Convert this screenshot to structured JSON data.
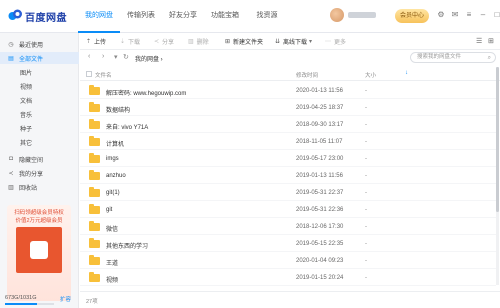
{
  "app": {
    "title": "百度网盘"
  },
  "nav": [
    {
      "label": "我的网盘",
      "active": true
    },
    {
      "label": "传输列表",
      "active": false
    },
    {
      "label": "好友分享",
      "active": false
    },
    {
      "label": "功能宝箱",
      "active": false
    },
    {
      "label": "找资源",
      "active": false
    }
  ],
  "header": {
    "member_label": "会员中心"
  },
  "sidebar": {
    "items": [
      {
        "icon": "clock-icon",
        "glyph": "◷",
        "label": "最近使用",
        "active": false,
        "sub": false
      },
      {
        "icon": "files-icon",
        "glyph": "▤",
        "label": "全部文件",
        "active": true,
        "sub": false
      },
      {
        "icon": "",
        "glyph": "",
        "label": "图片",
        "active": false,
        "sub": true
      },
      {
        "icon": "",
        "glyph": "",
        "label": "视频",
        "active": false,
        "sub": true
      },
      {
        "icon": "",
        "glyph": "",
        "label": "文档",
        "active": false,
        "sub": true
      },
      {
        "icon": "",
        "glyph": "",
        "label": "音乐",
        "active": false,
        "sub": true
      },
      {
        "icon": "",
        "glyph": "",
        "label": "种子",
        "active": false,
        "sub": true
      },
      {
        "icon": "",
        "glyph": "",
        "label": "其它",
        "active": false,
        "sub": true
      },
      {
        "icon": "lock-icon",
        "glyph": "◘",
        "label": "隐藏空间",
        "active": false,
        "sub": false
      },
      {
        "icon": "share-icon",
        "glyph": "≺",
        "label": "我的分享",
        "active": false,
        "sub": false
      },
      {
        "icon": "trash-icon",
        "glyph": "▥",
        "label": "回收站",
        "active": false,
        "sub": false
      }
    ],
    "promo": {
      "line1": "扫码领超级会员特权",
      "line2": "价值2万元超级会员"
    },
    "storage": {
      "text": "673G/1031G",
      "expand_label": "扩容",
      "used_fraction": 0.653
    }
  },
  "toolbar": {
    "upload": "上传",
    "download": "下载",
    "share": "分享",
    "delete": "删除",
    "new_folder": "新建文件夹",
    "offline_download": "离线下载",
    "more": "更多"
  },
  "path": {
    "crumb": "我的网盘 ›",
    "search_placeholder": "搜索我的网盘文件"
  },
  "table": {
    "headers": {
      "name": "文件名",
      "date": "修改时间",
      "size": "大小"
    },
    "rows": [
      {
        "name": "解压密码: www.hegouwip.com",
        "date": "2020-01-13 11:56",
        "size": "-"
      },
      {
        "name": "数据结构",
        "date": "2019-04-25 18:37",
        "size": "-"
      },
      {
        "name": "来自: vivo Y71A",
        "date": "2018-09-30 13:17",
        "size": "-"
      },
      {
        "name": "计算机",
        "date": "2018-11-05 11:07",
        "size": "-"
      },
      {
        "name": "imgs",
        "date": "2019-05-17 23:00",
        "size": "-"
      },
      {
        "name": "anzhuo",
        "date": "2019-01-13 11:56",
        "size": "-"
      },
      {
        "name": "git(1)",
        "date": "2019-05-31 22:37",
        "size": "-"
      },
      {
        "name": "git",
        "date": "2019-05-31 22:36",
        "size": "-"
      },
      {
        "name": "微信",
        "date": "2018-12-06 17:30",
        "size": "-"
      },
      {
        "name": "其他东西的学习",
        "date": "2019-05-15 22:35",
        "size": "-"
      },
      {
        "name": "王道",
        "date": "2020-01-04 09:23",
        "size": "-"
      },
      {
        "name": "视频",
        "date": "2019-01-15 20:24",
        "size": "-"
      }
    ]
  },
  "footer": {
    "count": "27项"
  }
}
